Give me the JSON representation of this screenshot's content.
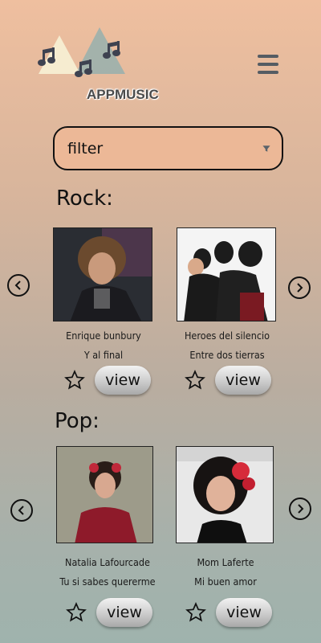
{
  "header": {
    "brand": "APPMUSIC",
    "logo_icon": "music-notes-logo",
    "menu_icon": "hamburger-menu-icon"
  },
  "search": {
    "placeholder": "filter",
    "filter_icon": "funnel-icon"
  },
  "sections": [
    {
      "title": "Rock:",
      "cards": [
        {
          "artist": "Enrique bunbury",
          "song": "Y al final",
          "button": "view"
        },
        {
          "artist": "Heroes del silencio",
          "song": "Entre dos tierras",
          "button": "view"
        }
      ]
    },
    {
      "title": "Pop:",
      "cards": [
        {
          "artist": "Natalia Lafourcade",
          "song": "Tu si sabes quererme",
          "button": "view"
        },
        {
          "artist": "Mom Laferte",
          "song": "Mi buen amor",
          "button": "view"
        }
      ]
    }
  ],
  "colors": {
    "background_top": "#efbf9f",
    "background_bottom": "#9fb3ad",
    "search_fill": "#ecb897"
  }
}
